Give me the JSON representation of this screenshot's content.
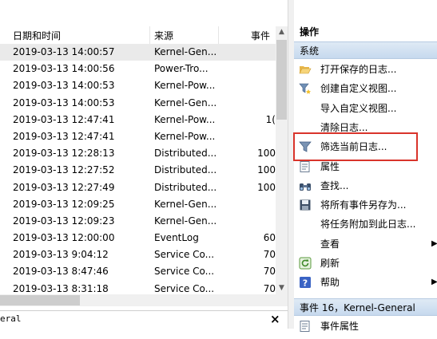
{
  "event_list": {
    "columns": {
      "datetime": "日期和时间",
      "source": "来源",
      "event_id": "事件"
    },
    "rows": [
      {
        "datetime": "2019-03-13 14:00:57",
        "source": "Kernel-Gen...",
        "event": ""
      },
      {
        "datetime": "2019-03-13 14:00:56",
        "source": "Power-Tro...",
        "event": ""
      },
      {
        "datetime": "2019-03-13 14:00:53",
        "source": "Kernel-Pow...",
        "event": ""
      },
      {
        "datetime": "2019-03-13 14:00:53",
        "source": "Kernel-Gen...",
        "event": ""
      },
      {
        "datetime": "2019-03-13 12:47:41",
        "source": "Kernel-Pow...",
        "event": "1("
      },
      {
        "datetime": "2019-03-13 12:47:41",
        "source": "Kernel-Pow...",
        "event": ""
      },
      {
        "datetime": "2019-03-13 12:28:13",
        "source": "Distributed...",
        "event": "100"
      },
      {
        "datetime": "2019-03-13 12:27:52",
        "source": "Distributed...",
        "event": "100"
      },
      {
        "datetime": "2019-03-13 12:27:49",
        "source": "Distributed...",
        "event": "100"
      },
      {
        "datetime": "2019-03-13 12:09:25",
        "source": "Kernel-Gen...",
        "event": ""
      },
      {
        "datetime": "2019-03-13 12:09:23",
        "source": "Kernel-Gen...",
        "event": ""
      },
      {
        "datetime": "2019-03-13 12:00:00",
        "source": "EventLog",
        "event": "60"
      },
      {
        "datetime": "2019-03-13 9:04:12",
        "source": "Service Co...",
        "event": "70"
      },
      {
        "datetime": "2019-03-13 8:47:46",
        "source": "Service Co...",
        "event": "70"
      },
      {
        "datetime": "2019-03-13 8:31:18",
        "source": "Service Co...",
        "event": "70"
      }
    ],
    "selected_index": 0
  },
  "bottom_pane": {
    "title": "eral",
    "close": "×"
  },
  "actions_pane": {
    "title": "操作",
    "section_system": "系统",
    "items": [
      {
        "label": "打开保存的日志...",
        "icon": "folder-open-icon"
      },
      {
        "label": "创建自定义视图...",
        "icon": "filter-star-icon"
      },
      {
        "label": "导入自定义视图...",
        "icon": ""
      },
      {
        "label": "清除日志...",
        "icon": ""
      },
      {
        "label": "筛选当前日志...",
        "icon": "filter-icon"
      },
      {
        "label": "属性",
        "icon": "properties-icon"
      },
      {
        "label": "查找...",
        "icon": "binoculars-icon"
      },
      {
        "label": "将所有事件另存为...",
        "icon": "save-icon"
      },
      {
        "label": "将任务附加到此日志...",
        "icon": ""
      },
      {
        "label": "查看",
        "icon": "",
        "submenu": "▶"
      },
      {
        "label": "刷新",
        "icon": "refresh-icon"
      },
      {
        "label": "帮助",
        "icon": "help-icon",
        "submenu": "▶"
      }
    ],
    "section_event": "事件 16，Kernel-General",
    "event_items": [
      {
        "label": "事件属性",
        "icon": "properties-icon"
      }
    ]
  },
  "colors": {
    "highlight_border": "#d9342b",
    "section_header": "#c6d9ee",
    "selected_row": "#eaeaea"
  }
}
